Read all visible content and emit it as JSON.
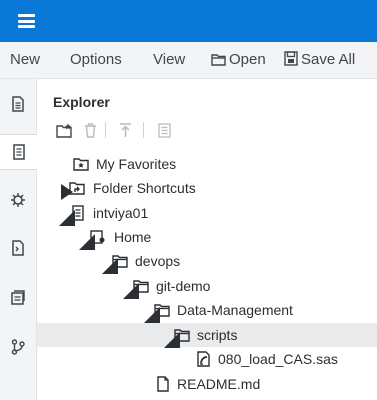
{
  "toolbar": {
    "new_label": "New",
    "options_label": "Options",
    "view_label": "View",
    "open_label": "Open",
    "save_all_label": "Save All"
  },
  "explorer": {
    "title": "Explorer",
    "tree": [
      {
        "label": "My Favorites",
        "icon": "favorites-folder-icon"
      },
      {
        "label": "Folder Shortcuts",
        "icon": "folder-shortcut-icon",
        "expanded": false
      },
      {
        "label": "intviya01",
        "icon": "server-icon",
        "expanded": true
      },
      {
        "label": "Home",
        "icon": "home-icon",
        "expanded": true
      },
      {
        "label": "devops",
        "icon": "folder-icon",
        "expanded": true
      },
      {
        "label": "git-demo",
        "icon": "folder-icon",
        "expanded": true
      },
      {
        "label": "Data-Management",
        "icon": "folder-icon",
        "expanded": true
      },
      {
        "label": "scripts",
        "icon": "folder-icon",
        "expanded": true,
        "selected": true
      },
      {
        "label": "080_load_CAS.sas",
        "icon": "sas-program-icon"
      },
      {
        "label": "README.md",
        "icon": "file-icon"
      }
    ]
  },
  "colors": {
    "header_blue": "#0a78d7",
    "menubar_bg": "#f3f4f5",
    "selected_row": "#e8eaec"
  }
}
